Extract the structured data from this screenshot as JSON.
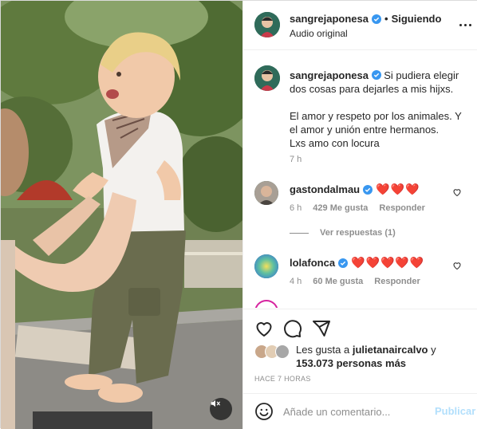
{
  "post": {
    "author": "sangrejaponesa",
    "verified": true,
    "separator": "•",
    "follow_status": "Siguiendo",
    "audio": "Audio original",
    "more_icon": "more-horizontal-icon"
  },
  "caption": {
    "username": "sangrejaponesa",
    "line1": "Si pudiera elegir dos cosas para dejarles a mis hijxs.",
    "line2": "El amor y respeto por los animales. Y el amor y unión entre hermanos.",
    "line3": "Lxs amo con locura",
    "time": "7 h"
  },
  "comments": [
    {
      "username": "gastondalmau",
      "verified": true,
      "text": "❤️❤️❤️",
      "time": "6 h",
      "likes": "429 Me gusta",
      "reply": "Responder"
    },
    {
      "username": "lolafonca",
      "verified": true,
      "text": "❤️❤️❤️❤️❤️",
      "time": "4 h",
      "likes": "60 Me gusta",
      "reply": "Responder"
    }
  ],
  "view_replies": "Ver respuestas (1)",
  "actions": {
    "like_icon": "heart-icon",
    "comment_icon": "comment-icon",
    "share_icon": "share-icon",
    "likes_prefix": "Les gusta a",
    "likes_user": "julietanaircalvo",
    "likes_conj": "y",
    "likes_count": "153.073 personas más",
    "ago": "HACE 7 HORAS"
  },
  "add_comment": {
    "emoji_icon": "emoji-icon",
    "placeholder": "Añade un comentario...",
    "post_label": "Publicar"
  },
  "media": {
    "mute_icon": "speaker-muted-icon"
  },
  "colors": {
    "verified": "#3897f0",
    "heart": "#ed1c24",
    "publish": "#b2dffc",
    "muted_text": "#8e8e8e"
  }
}
